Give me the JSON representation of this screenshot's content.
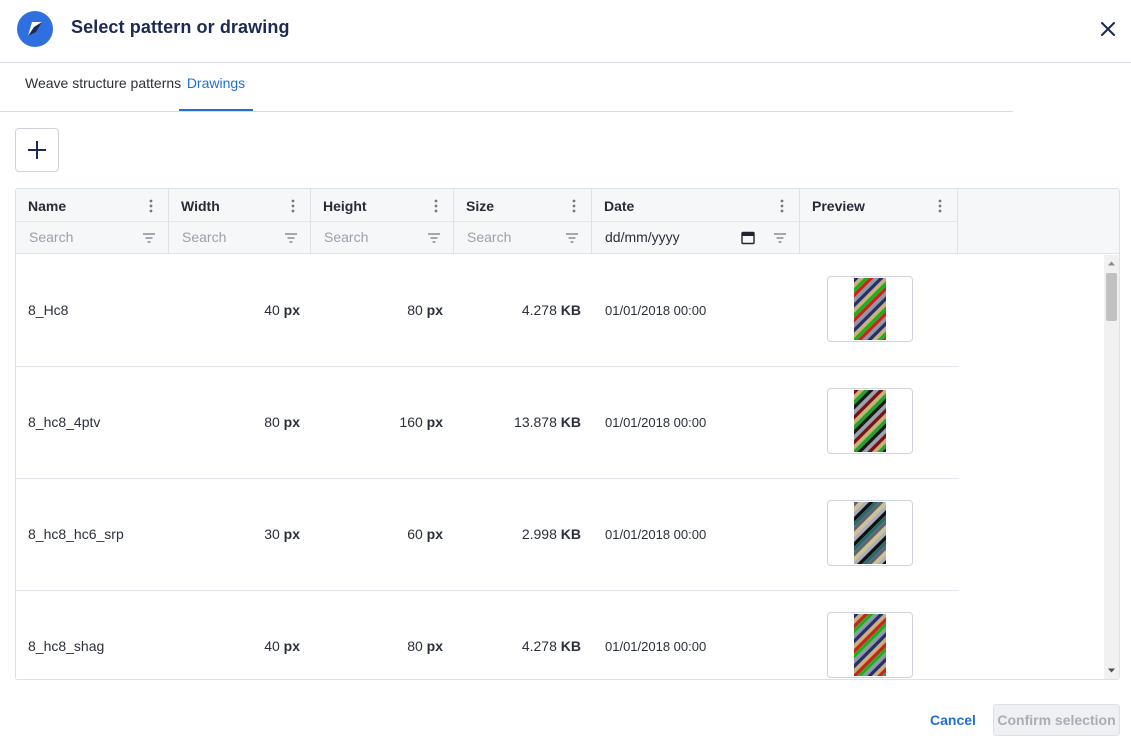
{
  "dialog": {
    "title": "Select pattern or drawing"
  },
  "tabs": [
    {
      "label": "Weave structure patterns",
      "active": false
    },
    {
      "label": "Drawings",
      "active": true
    }
  ],
  "table": {
    "columns": [
      {
        "label": "Name",
        "filter_placeholder": "Search"
      },
      {
        "label": "Width",
        "filter_placeholder": "Search"
      },
      {
        "label": "Height",
        "filter_placeholder": "Search"
      },
      {
        "label": "Size",
        "filter_placeholder": "Search"
      },
      {
        "label": "Date",
        "filter_placeholder": "dd/mm/yyyy"
      },
      {
        "label": "Preview"
      }
    ],
    "rows": [
      {
        "name": "8_Hc8",
        "width": "40",
        "height": "80",
        "size": "4.278",
        "date": "01/01/2018 00:00",
        "preview_colors": [
          "#2a2f6b",
          "#c8b27a",
          "#1db01d",
          "#c8261d",
          "#8d98a8"
        ]
      },
      {
        "name": "8_hc8_4ptv",
        "width": "80",
        "height": "160",
        "size": "13.878",
        "date": "01/01/2018 00:00",
        "preview_colors": [
          "#7a1410",
          "#c8b27a",
          "#22a42a",
          "#1a1a1a",
          "#9aa3b3"
        ]
      },
      {
        "name": "8_hc8_hc6_srp",
        "width": "30",
        "height": "60",
        "size": "2.998",
        "date": "01/01/2018 00:00",
        "preview_colors": [
          "#5e6470",
          "#d2c08e",
          "#a8b0bd",
          "#111111",
          "#2b6a6a"
        ]
      },
      {
        "name": "8_hc8_shag",
        "width": "40",
        "height": "80",
        "size": "4.278",
        "date": "01/01/2018 00:00",
        "preview_colors": [
          "#2a2f6b",
          "#c8b27a",
          "#c8261d",
          "#1db01d",
          "#8d98a8"
        ]
      }
    ],
    "units": {
      "dimension": "px",
      "size": "KB"
    }
  },
  "footer": {
    "cancel_label": "Cancel",
    "confirm_label": "Confirm selection"
  },
  "colors": {
    "accent": "#1f6fd6",
    "title": "#1b2a55",
    "logo": "#2f6fe0"
  }
}
